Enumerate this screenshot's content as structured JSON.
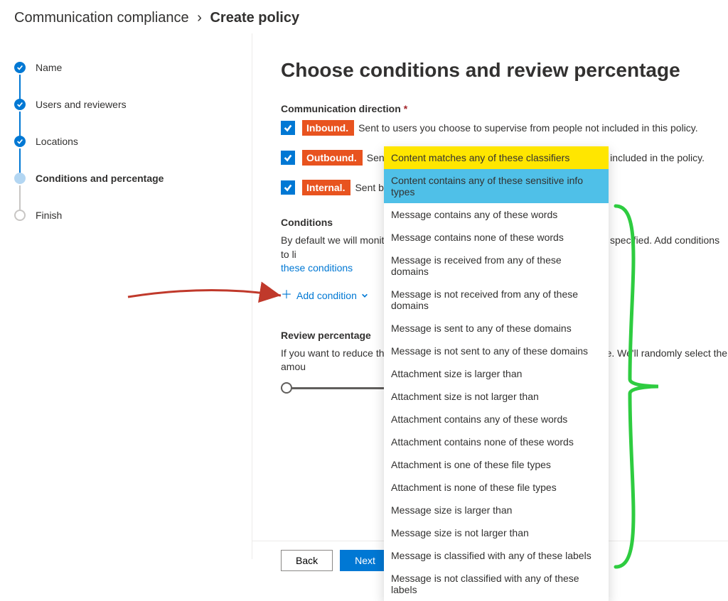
{
  "breadcrumb": {
    "parent": "Communication compliance",
    "current": "Create policy"
  },
  "steps": [
    {
      "label": "Name",
      "state": "done"
    },
    {
      "label": "Users and reviewers",
      "state": "done"
    },
    {
      "label": "Locations",
      "state": "done"
    },
    {
      "label": "Conditions and percentage",
      "state": "current"
    },
    {
      "label": "Finish",
      "state": "pending"
    }
  ],
  "main": {
    "heading": "Choose conditions and review percentage",
    "direction_label": "Communication direction",
    "directions": [
      {
        "tag": "Inbound.",
        "desc": "Sent to users you choose to supervise from people not included in this policy."
      },
      {
        "tag": "Outbound.",
        "desc": "Sent from users you choose to supervise to people not included in the policy."
      },
      {
        "tag": "Internal.",
        "desc": "Sent between the users or groups you identify."
      }
    ],
    "conditions_label": "Conditions",
    "conditions_desc_part1": "By default we will monitor all communications regardless of any conditions specified. Add conditions to li",
    "conditions_link": "these conditions",
    "add_condition_label": "Add condition",
    "review_label": "Review percentage",
    "review_desc": "If you want to reduce the amount of content to review, specify a percentage. We'll randomly select the amou"
  },
  "dropdown_options": [
    {
      "label": "Content matches any of these classifiers",
      "highlight": "yellow"
    },
    {
      "label": "Content contains any of these sensitive info types",
      "highlight": "blue"
    },
    {
      "label": "Message contains any of these words"
    },
    {
      "label": "Message contains none of these words"
    },
    {
      "label": "Message is received from any of these domains"
    },
    {
      "label": "Message is not received from any of these domains"
    },
    {
      "label": "Message is sent to any of these domains"
    },
    {
      "label": "Message is not sent to any of these domains"
    },
    {
      "label": "Attachment size is larger than"
    },
    {
      "label": "Attachment size is not larger than"
    },
    {
      "label": "Attachment contains any of these words"
    },
    {
      "label": "Attachment contains none of these words"
    },
    {
      "label": "Attachment is one of these file types"
    },
    {
      "label": "Attachment is none of these file types"
    },
    {
      "label": "Message size is larger than"
    },
    {
      "label": "Message size is not larger than"
    },
    {
      "label": "Message is classified with any of these labels"
    },
    {
      "label": "Message is not classified with any of these labels"
    }
  ],
  "footer": {
    "back": "Back",
    "next": "Next"
  }
}
